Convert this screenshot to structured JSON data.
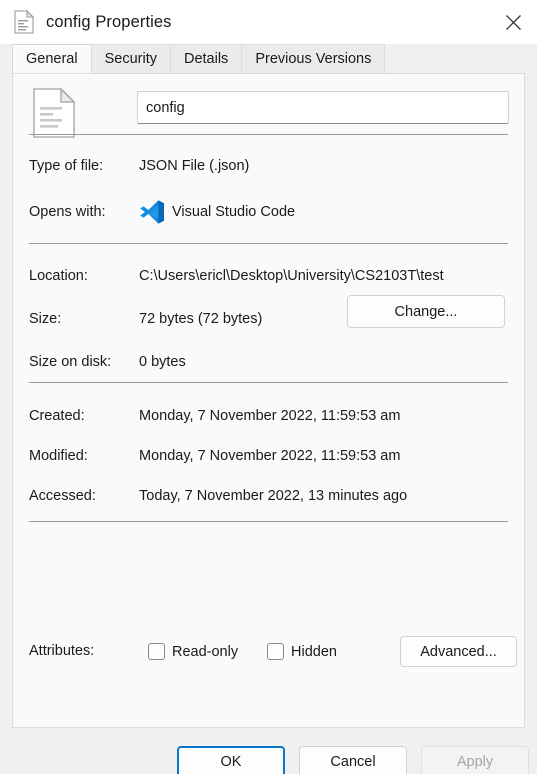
{
  "window": {
    "title": "config Properties",
    "icon": "file-document-icon",
    "close_label": "Close"
  },
  "tabs": [
    {
      "label": "General",
      "active": true
    },
    {
      "label": "Security",
      "active": false
    },
    {
      "label": "Details",
      "active": false
    },
    {
      "label": "Previous Versions",
      "active": false
    }
  ],
  "general": {
    "file_icon": "file-document-icon",
    "filename_value": "config",
    "filename_placeholder": "File name",
    "rows": [
      {
        "label": "Type of file:",
        "value": "JSON File (.json)"
      },
      {
        "label": "Opens with:",
        "value": "Visual Studio Code"
      },
      {
        "label": "Location:",
        "value": "C:\\Users\\ericl\\Desktop\\University\\CS2103T\\test"
      },
      {
        "label": "Size:",
        "value": "72 bytes (72 bytes)"
      },
      {
        "label": "Size on disk:",
        "value": "0 bytes"
      },
      {
        "label": "Created:",
        "value": "Monday, 7 November 2022, 11:59:53 am"
      },
      {
        "label": "Modified:",
        "value": "Monday, 7 November 2022, 11:59:53 am"
      },
      {
        "label": "Accessed:",
        "value": "Today, 7 November 2022, 13 minutes ago"
      },
      {
        "label": "Attributes:",
        "value": ""
      }
    ],
    "opens_with_app_icon": "visual-studio-code-icon",
    "change_button": "Change...",
    "attributes": {
      "readonly_label": "Read-only",
      "readonly_checked": false,
      "hidden_label": "Hidden",
      "hidden_checked": false,
      "advanced_button": "Advanced..."
    }
  },
  "footer": {
    "ok": "OK",
    "cancel": "Cancel",
    "apply": "Apply",
    "apply_disabled": true
  },
  "colors": {
    "accent": "#0b76c8",
    "panel_bg": "#fafafa",
    "dialog_bg": "#f0f0f0",
    "vscode_blue": "#0f8ce0",
    "vscode_blue_dark": "#0a69b5",
    "separator": "#9a9a9a",
    "disabled_text": "#a6a6a6"
  }
}
